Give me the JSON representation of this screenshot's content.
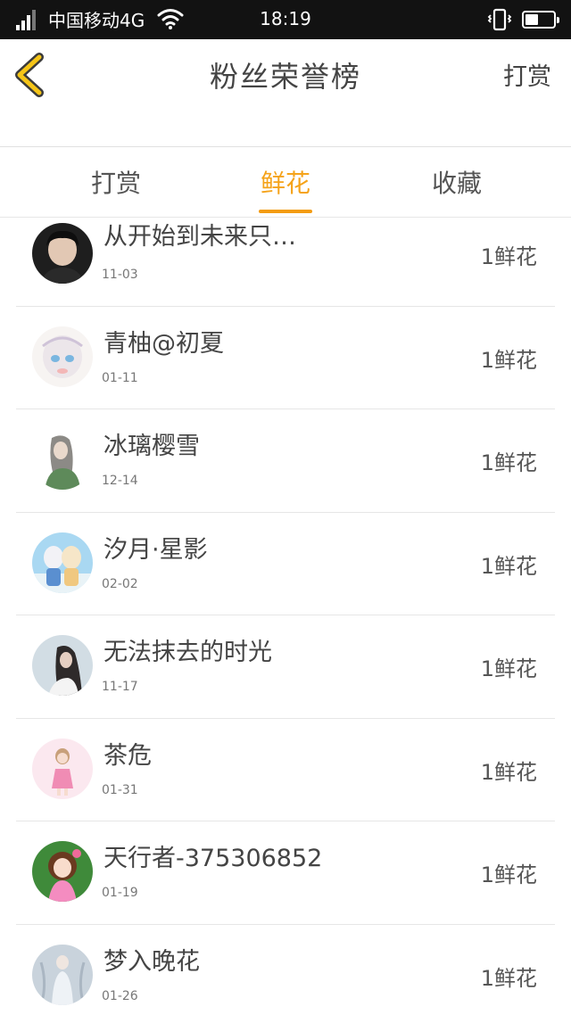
{
  "status_bar": {
    "carrier": "中国移动4G",
    "time": "18:19",
    "battery_level": 0.45
  },
  "header": {
    "back_icon": "chevron-left-icon",
    "title": "粉丝荣誉榜",
    "right_action": "打赏"
  },
  "tabs": [
    {
      "label": "打赏",
      "active": false
    },
    {
      "label": "鲜花",
      "active": true
    },
    {
      "label": "收藏",
      "active": false
    }
  ],
  "colors": {
    "accent": "#f39c12",
    "back_icon": "#f5c518",
    "status_bar_bg": "#121212"
  },
  "fans": [
    {
      "name": "从开始到未来只…",
      "date": "11-03",
      "gift": "1鲜花",
      "avatar_icon": "avatar-photo-boy"
    },
    {
      "name": "青柚@初夏",
      "date": "01-11",
      "gift": "1鲜花",
      "avatar_icon": "avatar-anime-girl"
    },
    {
      "name": "冰璃樱雪",
      "date": "12-14",
      "gift": "1鲜花",
      "avatar_icon": "avatar-illustration-girl"
    },
    {
      "name": "汐月·星影",
      "date": "02-02",
      "gift": "1鲜花",
      "avatar_icon": "avatar-anime-pair"
    },
    {
      "name": "无法抹去的时光",
      "date": "11-17",
      "gift": "1鲜花",
      "avatar_icon": "avatar-photo-woman"
    },
    {
      "name": "茶危",
      "date": "01-31",
      "gift": "1鲜花",
      "avatar_icon": "avatar-pixel-girl"
    },
    {
      "name": "天行者-375306852",
      "date": "01-19",
      "gift": "1鲜花",
      "avatar_icon": "avatar-doll-girl"
    },
    {
      "name": "梦入晚花",
      "date": "01-26",
      "gift": "1鲜花",
      "avatar_icon": "avatar-fantasy-woman"
    }
  ]
}
